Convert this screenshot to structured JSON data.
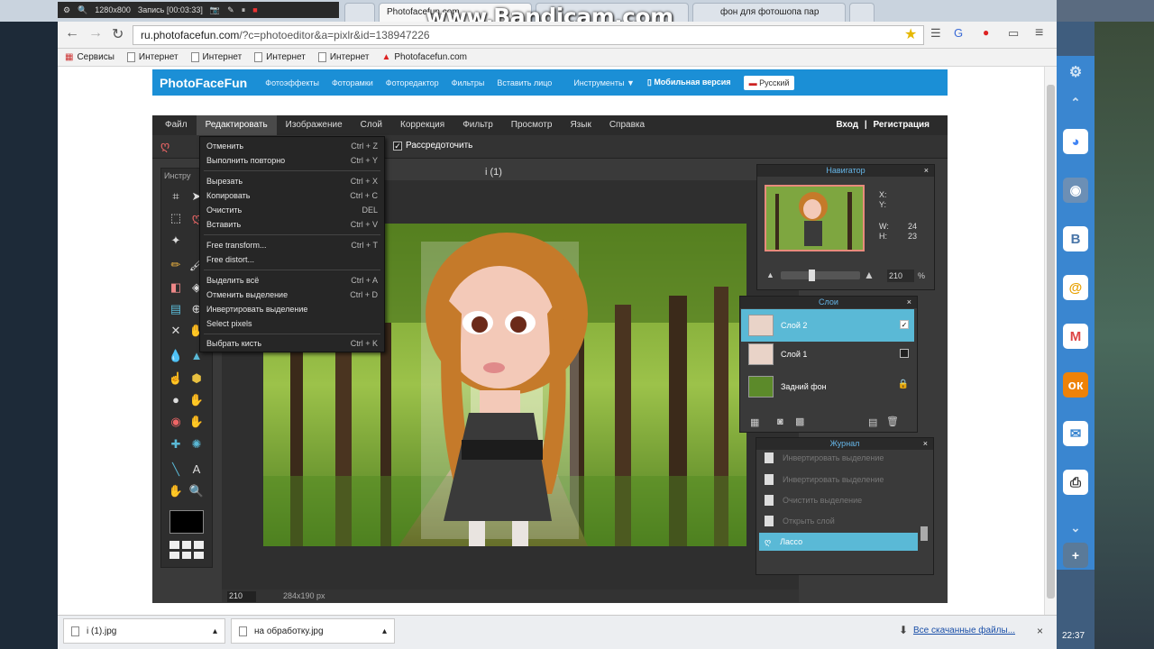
{
  "bandicam": {
    "resolution": "1280x800",
    "recording": "Запись [00:03:33]"
  },
  "watermark": "www.Bandicam.com",
  "tabs": [
    {
      "label": "Photofacefun.com"
    },
    {
      "label": "фон для фотошопа пар"
    }
  ],
  "address": {
    "host": "ru.photofacefun.com",
    "path": "/?c=photoeditor&a=pixlr&id=138947226"
  },
  "bookmarks": [
    "Сервисы",
    "Интернет",
    "Интернет",
    "Интернет",
    "Интернет",
    "Photofacefun.com"
  ],
  "site_nav": {
    "logo": "PhotoFaceFun",
    "items": [
      "Фотоэффекты",
      "Фоторамки",
      "Фоторедактор",
      "Фильтры",
      "Вставить лицо",
      "Инструменты ▼"
    ],
    "mobile": "Мобильная версия",
    "language": "Русский"
  },
  "editor_menu": [
    "Файл",
    "Редактировать",
    "Изображение",
    "Слой",
    "Коррекция",
    "Фильтр",
    "Просмотр",
    "Язык",
    "Справка"
  ],
  "auth": {
    "login": "Вход",
    "separator": "|",
    "register": "Регистрация"
  },
  "options": {
    "feather_label": "Рассредоточить",
    "feather_checked": "✓"
  },
  "tools_title": "Инстру",
  "edit_menu": [
    {
      "label": "Отменить",
      "shortcut": "Ctrl + Z"
    },
    {
      "label": "Выполнить повторно",
      "shortcut": "Ctrl + Y"
    },
    {
      "label": "Вырезать",
      "shortcut": "Ctrl + X"
    },
    {
      "label": "Копировать",
      "shortcut": "Ctrl + C"
    },
    {
      "label": "Очистить",
      "shortcut": "DEL"
    },
    {
      "label": "Вставить",
      "shortcut": "Ctrl + V"
    },
    {
      "label": "Free transform...",
      "shortcut": "Ctrl + T"
    },
    {
      "label": "Free distort...",
      "shortcut": ""
    },
    {
      "label": "Выделить всё",
      "shortcut": "Ctrl + A"
    },
    {
      "label": "Отменить выделение",
      "shortcut": "Ctrl + D"
    },
    {
      "label": "Инвертировать выделение",
      "shortcut": ""
    },
    {
      "label": "Select pixels",
      "shortcut": ""
    },
    {
      "label": "Выбрать кисть",
      "shortcut": "Ctrl + K"
    }
  ],
  "document": {
    "title": "i (1)",
    "zoom": "210",
    "size": "284x190 px"
  },
  "navigator": {
    "title": "Навигатор",
    "x_label": "X:",
    "y_label": "Y:",
    "w_label": "W:",
    "w_value": "24",
    "h_label": "H:",
    "h_value": "23",
    "zoom": "210",
    "zoom_unit": "%"
  },
  "layers": {
    "title": "Слои",
    "items": [
      {
        "name": "Слой 2",
        "selected": true
      },
      {
        "name": "Слой 1",
        "selected": false
      },
      {
        "name": "Задний фон",
        "selected": false
      }
    ]
  },
  "history": {
    "title": "Журнал",
    "items": [
      "Инвертировать выделение",
      "Инвертировать выделение",
      "Очистить выделение",
      "Открыть слой"
    ],
    "current": "Лассо"
  },
  "downloads": [
    {
      "name": "i (1).jpg"
    },
    {
      "name": "на обработку.jpg"
    }
  ],
  "downloads_all": "Все скачанные файлы...",
  "clock": "22:37",
  "colors": {
    "site_nav": "#1b8fd6",
    "selection": "#5ab9d6",
    "panel_title": "#66b6e8"
  }
}
